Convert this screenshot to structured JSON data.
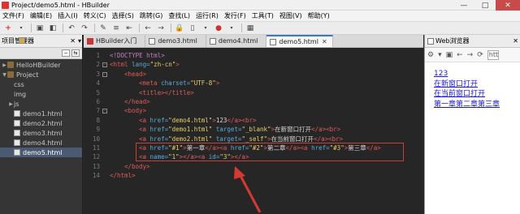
{
  "window": {
    "title": "Project/demo5.html - HBuilder",
    "min": "—",
    "max": "□",
    "close": "✕"
  },
  "menu": [
    "文件(F)",
    "编辑(E)",
    "插入(I)",
    "转义(C)",
    "选择(S)",
    "跳转(G)",
    "查找(L)",
    "运行(R)",
    "发行(F)",
    "工具(T)",
    "视图(V)",
    "帮助(Y)"
  ],
  "left_panel": {
    "title": "项目管理器",
    "close": "✕",
    "tree": [
      {
        "label": "HelloHBuilder",
        "kind": "proj",
        "arrow": "▶",
        "indent": 0,
        "selected": false
      },
      {
        "label": "Project",
        "kind": "proj",
        "arrow": "▼",
        "indent": 0,
        "selected": false
      },
      {
        "label": "css",
        "kind": "fold",
        "arrow": "",
        "indent": 1,
        "selected": false
      },
      {
        "label": "img",
        "kind": "fold",
        "arrow": "",
        "indent": 1,
        "selected": false
      },
      {
        "label": "js",
        "kind": "fold",
        "arrow": "▶",
        "indent": 1,
        "selected": false
      },
      {
        "label": "demo1.html",
        "kind": "html",
        "arrow": "",
        "indent": 1,
        "selected": false
      },
      {
        "label": "demo2.html",
        "kind": "html",
        "arrow": "",
        "indent": 1,
        "selected": false
      },
      {
        "label": "demo3.html",
        "kind": "html",
        "arrow": "",
        "indent": 1,
        "selected": false
      },
      {
        "label": "demo4.html",
        "kind": "html",
        "arrow": "",
        "indent": 1,
        "selected": false
      },
      {
        "label": "demo5.html",
        "kind": "html",
        "arrow": "",
        "indent": 1,
        "selected": true
      }
    ]
  },
  "tabs": [
    {
      "label": "HBuilder入门",
      "icon": "hb",
      "active": false,
      "close": ""
    },
    {
      "label": "demo3.html",
      "icon": "h",
      "active": false,
      "close": ""
    },
    {
      "label": "demo4.html",
      "icon": "h",
      "active": false,
      "close": ""
    },
    {
      "label": "demo5.html",
      "icon": "h",
      "active": true,
      "close": "✕"
    }
  ],
  "editor": {
    "lines": [
      {
        "n": "1",
        "fold": "",
        "indent": 0,
        "segs": [
          [
            "dt",
            "<!DOCTYPE html>"
          ]
        ]
      },
      {
        "n": "2",
        "fold": "-",
        "indent": 0,
        "segs": [
          [
            "tag",
            "<html "
          ],
          [
            "attr",
            "lang="
          ],
          [
            "str",
            "\"zh-cn\""
          ],
          [
            "tag",
            ">"
          ]
        ]
      },
      {
        "n": "3",
        "fold": "-",
        "indent": 1,
        "segs": [
          [
            "tag",
            "<head>"
          ]
        ]
      },
      {
        "n": "4",
        "fold": "",
        "indent": 2,
        "segs": [
          [
            "tag",
            "<meta "
          ],
          [
            "attr",
            "charset="
          ],
          [
            "str",
            "\"UTF-8\""
          ],
          [
            "tag",
            ">"
          ]
        ]
      },
      {
        "n": "5",
        "fold": "",
        "indent": 2,
        "segs": [
          [
            "tag",
            "<title></title>"
          ]
        ]
      },
      {
        "n": "6",
        "fold": "",
        "indent": 1,
        "segs": [
          [
            "tag",
            "</head>"
          ]
        ]
      },
      {
        "n": "7",
        "fold": "-",
        "indent": 1,
        "segs": [
          [
            "tag",
            "<body>"
          ]
        ]
      },
      {
        "n": "8",
        "fold": "",
        "indent": 2,
        "segs": [
          [
            "tag",
            "<a "
          ],
          [
            "attr",
            "href="
          ],
          [
            "str",
            "\"demo4.html\""
          ],
          [
            "tag",
            ">"
          ],
          [
            "text",
            "123"
          ],
          [
            "tag",
            "</a><br>"
          ]
        ]
      },
      {
        "n": "9",
        "fold": "",
        "indent": 2,
        "segs": [
          [
            "tag",
            "<a "
          ],
          [
            "attr",
            "href="
          ],
          [
            "str",
            "\"demo1.html\""
          ],
          [
            "attr",
            " target="
          ],
          [
            "str",
            "\"_blank\""
          ],
          [
            "tag",
            ">"
          ],
          [
            "text",
            "在新窗口打开"
          ],
          [
            "tag",
            "</a><br>"
          ]
        ]
      },
      {
        "n": "10",
        "fold": "",
        "indent": 2,
        "segs": [
          [
            "tag",
            "<a "
          ],
          [
            "attr",
            "href="
          ],
          [
            "str",
            "\"demo2.html\""
          ],
          [
            "attr",
            " target="
          ],
          [
            "str",
            "\"_self\""
          ],
          [
            "tag",
            ">"
          ],
          [
            "text",
            "在当前窗口打开"
          ],
          [
            "tag",
            "</a><br>"
          ]
        ]
      },
      {
        "n": "11",
        "fold": "",
        "indent": 2,
        "segs": [
          [
            "tag",
            "<a "
          ],
          [
            "attr",
            "href="
          ],
          [
            "str",
            "\"#1\""
          ],
          [
            "tag",
            ">"
          ],
          [
            "text",
            "第一章"
          ],
          [
            "tag",
            "</a><a "
          ],
          [
            "attr",
            "href="
          ],
          [
            "str",
            "\"#2\""
          ],
          [
            "tag",
            ">"
          ],
          [
            "text",
            "第二章"
          ],
          [
            "tag",
            "</a><a "
          ],
          [
            "attr",
            "href="
          ],
          [
            "str",
            "\"#3\""
          ],
          [
            "tag",
            ">"
          ],
          [
            "text",
            "第三章"
          ],
          [
            "tag",
            "</a>"
          ]
        ]
      },
      {
        "n": "12",
        "fold": "",
        "indent": 2,
        "segs": [
          [
            "tag",
            "<a "
          ],
          [
            "attr",
            "name="
          ],
          [
            "str",
            "\"1\""
          ],
          [
            "tag",
            "></a><a "
          ],
          [
            "attr",
            "id="
          ],
          [
            "str",
            "\"3\""
          ],
          [
            "tag",
            "></a>"
          ]
        ]
      },
      {
        "n": "13",
        "fold": "",
        "indent": 1,
        "segs": [
          [
            "tag",
            "</body>"
          ]
        ]
      },
      {
        "n": "14",
        "fold": "",
        "indent": 0,
        "segs": [
          [
            "tag",
            "</html>"
          ]
        ]
      }
    ]
  },
  "browser": {
    "title": "Web浏览器",
    "close": "✕",
    "tools": [
      "⚙",
      "▾",
      "▣",
      "←",
      "→",
      "⟳"
    ],
    "url": "htt",
    "links": [
      "123",
      "在新窗口打开",
      "在当前窗口打开",
      "第一章第二章第三章"
    ]
  },
  "colors": {
    "accent": "#3a79c6",
    "highlight_box": "#d43a32",
    "tag": "#e05a5a",
    "attr": "#5ba9d6",
    "string": "#e6d06a"
  }
}
